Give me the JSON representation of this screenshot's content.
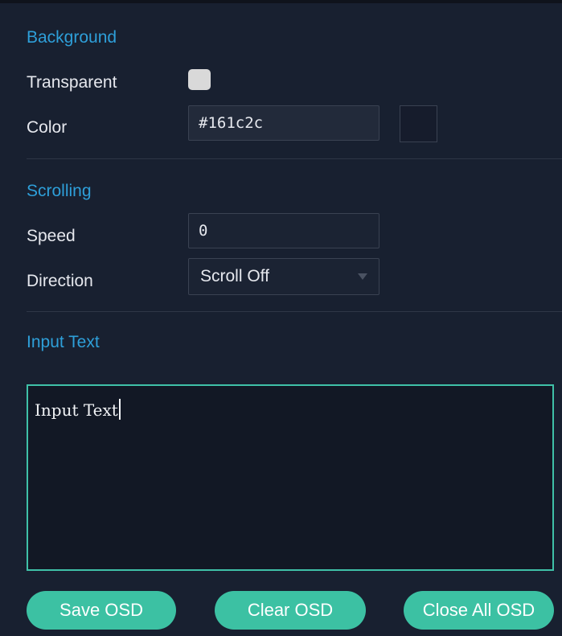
{
  "background": {
    "title": "Background",
    "transparent_label": "Transparent",
    "transparent_checked": false,
    "color_label": "Color",
    "color_value": "#161c2c",
    "swatch_color": "#161c2c"
  },
  "scrolling": {
    "title": "Scrolling",
    "speed_label": "Speed",
    "speed_value": "0",
    "direction_label": "Direction",
    "direction_value": "Scroll Off"
  },
  "input_text": {
    "title": "Input Text",
    "value": "Input Text"
  },
  "buttons": {
    "save": "Save OSD",
    "clear": "Clear OSD",
    "close_all": "Close All OSD"
  },
  "colors": {
    "accent_title": "#2e9fd9",
    "button": "#3cc1a3",
    "textarea_border": "#3fc1a8",
    "panel_bg": "#182030"
  },
  "icons": {
    "dropdown": "chevron-down-icon"
  }
}
